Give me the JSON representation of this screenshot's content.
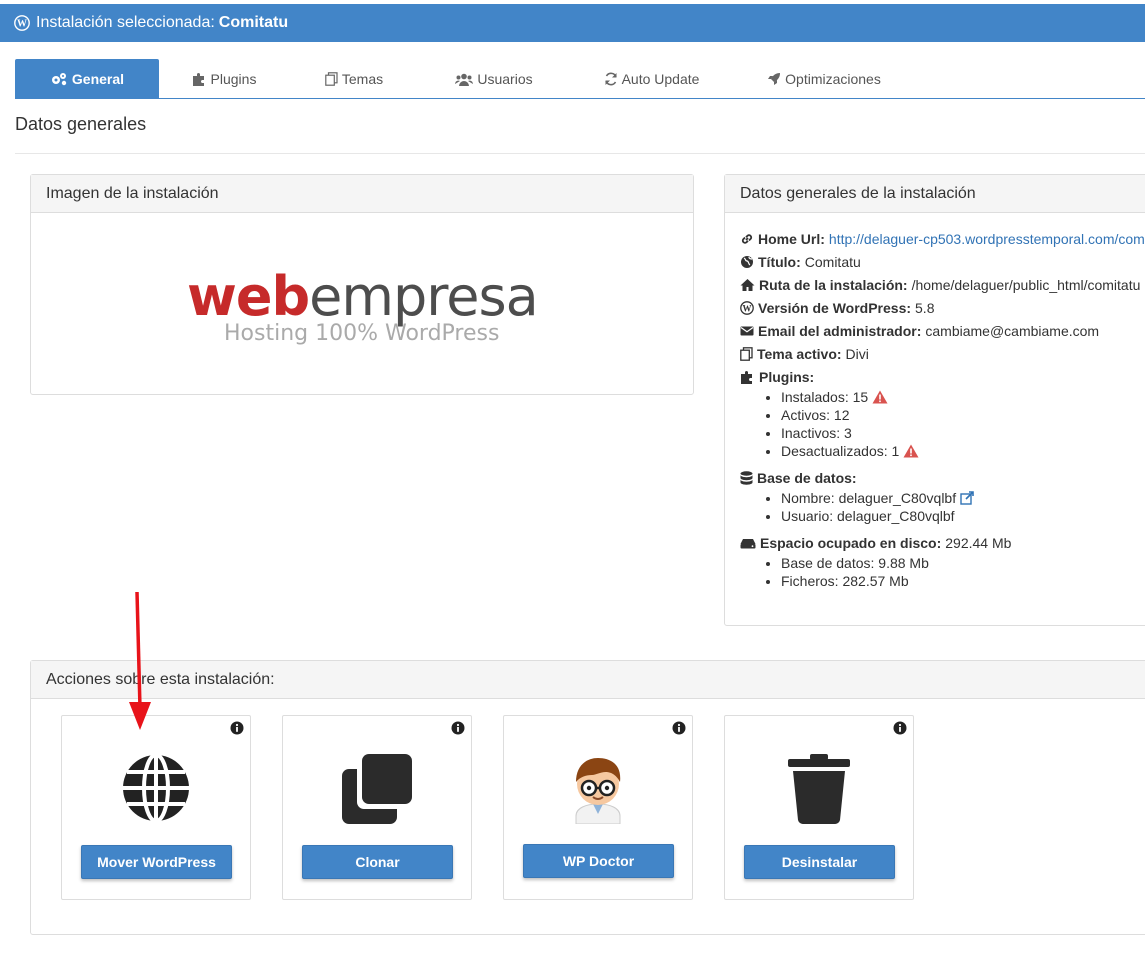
{
  "header": {
    "prefix": "Instalación seleccionada:",
    "installation": "Comitatu"
  },
  "tabs": [
    {
      "label": "General",
      "icon": "gears-icon",
      "active": true
    },
    {
      "label": "Plugins",
      "icon": "puzzle-icon",
      "active": false
    },
    {
      "label": "Temas",
      "icon": "copy-icon",
      "active": false
    },
    {
      "label": "Usuarios",
      "icon": "users-icon",
      "active": false
    },
    {
      "label": "Auto Update",
      "icon": "refresh-icon",
      "active": false
    },
    {
      "label": "Optimizaciones",
      "icon": "rocket-icon",
      "active": false
    }
  ],
  "section_title": "Datos generales",
  "image_panel": {
    "title": "Imagen de la instalación",
    "logo_web": "web",
    "logo_empresa": "empresa",
    "logo_tagline": "Hosting 100% WordPress"
  },
  "info_panel": {
    "title": "Datos generales de la instalación",
    "home_url_label": "Home Url:",
    "home_url": "http://delaguer-cp503.wordpresstemporal.com/com",
    "titulo_label": "Título:",
    "titulo": "Comitatu",
    "ruta_label": "Ruta de la instalación:",
    "ruta": "/home/delaguer/public_html/comitatu",
    "version_label": "Versión de WordPress:",
    "version": "5.8",
    "email_label": "Email del administrador:",
    "email": "cambiame@cambiame.com",
    "tema_label": "Tema activo:",
    "tema": "Divi",
    "plugins_label": "Plugins:",
    "plugins": {
      "instalados": "Instalados: 15",
      "activos": "Activos: 12",
      "inactivos": "Inactivos: 3",
      "desactualizados": "Desactualizados: 1"
    },
    "db_label": "Base de datos:",
    "db": {
      "nombre": "Nombre: delaguer_C80vqlbf",
      "usuario": "Usuario: delaguer_C80vqlbf"
    },
    "disk_label": "Espacio ocupado en disco:",
    "disk": "292.44 Mb",
    "disk_items": {
      "db": "Base de datos: 9.88 Mb",
      "files": "Ficheros: 282.57 Mb"
    }
  },
  "actions_panel": {
    "title": "Acciones sobre esta instalación:",
    "cards": [
      {
        "label": "Mover WordPress",
        "icon": "globe-icon"
      },
      {
        "label": "Clonar",
        "icon": "clone-icon"
      },
      {
        "label": "WP Doctor",
        "icon": "doctor-icon"
      },
      {
        "label": "Desinstalar",
        "icon": "trash-icon"
      }
    ]
  },
  "colors": {
    "primary": "#4285c8",
    "warning": "#d9534f",
    "annotation": "#e8131a"
  }
}
